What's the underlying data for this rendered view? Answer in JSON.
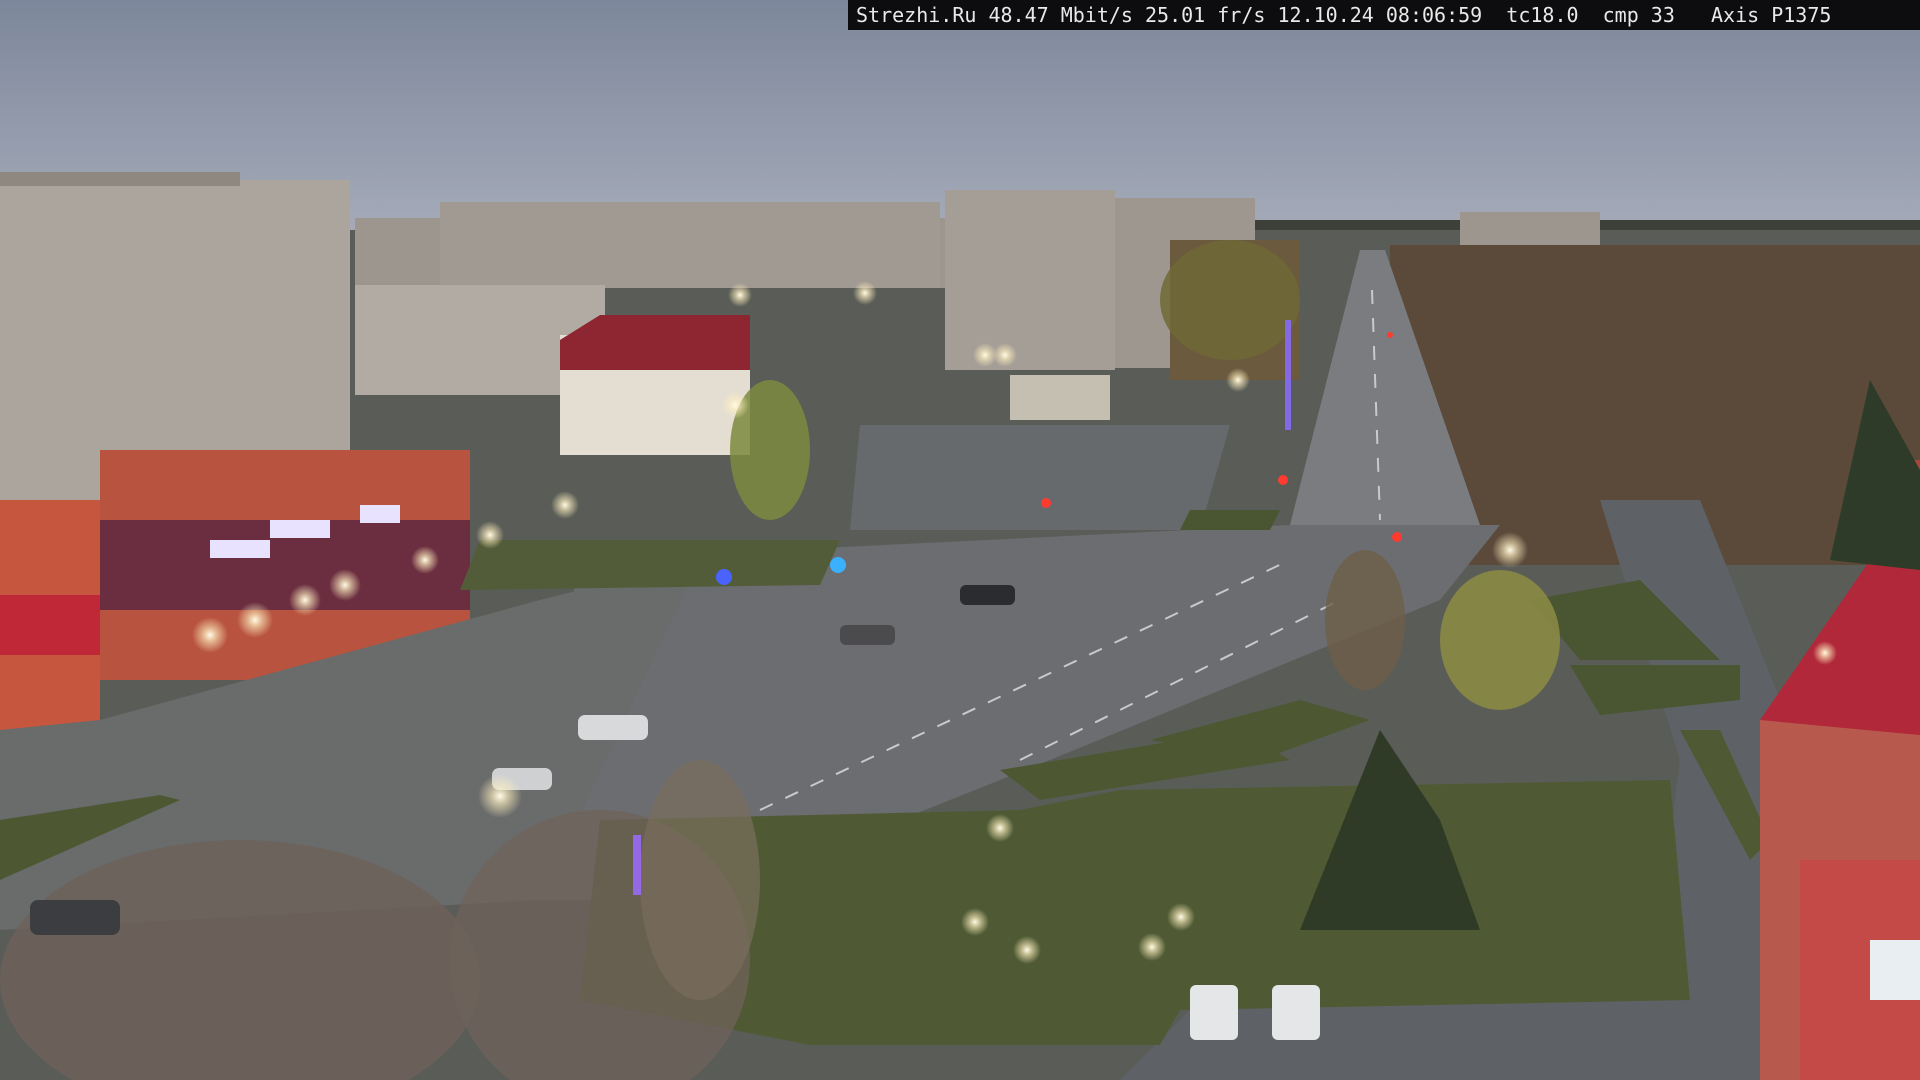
{
  "overlay": {
    "site": "Strezhi.Ru",
    "bitrate": "48.47 Mbit/s",
    "framerate": "25.01 fr/s",
    "date": "12.10.24",
    "time": "08:06:59",
    "tc": "tc18.0",
    "cmp": "cmp 33",
    "camera": "Axis P1375"
  },
  "colors": {
    "sky": "#8a93a6",
    "ground": "#5f6259",
    "road": "#6a6c70",
    "grass": "#4d5a34",
    "building_panel": "#a7a39f",
    "building_red": "#c74b3a",
    "lamp_glow": "#fff5d6"
  }
}
